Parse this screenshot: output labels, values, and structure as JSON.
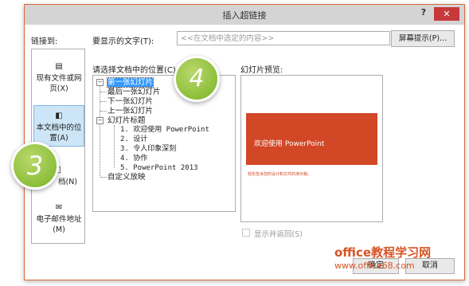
{
  "dialog": {
    "title": "插入超链接",
    "help": "?",
    "close": "✕"
  },
  "header": {
    "link_to_label": "链接到:",
    "display_text_label": "要显示的文字(T):",
    "display_text_value": "<<在文档中选定的内容>>",
    "screentip_button": "屏幕提示(P)..."
  },
  "nav": {
    "items": [
      {
        "label": "现有文件或网页(X)",
        "icon": "globe-file-icon"
      },
      {
        "label": "本文档中的位置(A)",
        "icon": "document-place-icon"
      },
      {
        "label": "新建文档(N)",
        "icon": "new-document-icon"
      },
      {
        "label": "电子邮件地址(M)",
        "icon": "email-icon"
      }
    ],
    "visible_labels": {
      "item0_line1": "现有文件或网",
      "item0_line2": "页(X)",
      "item1_line1": "本文档中的位",
      "item1_line2": "置(A)",
      "item2_visible": "档(N)",
      "item3_line1": "电子邮件地址",
      "item3_line2": "(M)"
    }
  },
  "place": {
    "label": "请选择文档中的位置(C):",
    "tree": {
      "first_slide": "第一张幻灯片",
      "last_slide": "最后一张幻灯片",
      "next_slide": "下一张幻灯片",
      "prev_slide": "上一张幻灯片",
      "slide_titles": "幻灯片标题",
      "titles": [
        "1. 欢迎使用 PowerPoint",
        "2. 设计",
        "3. 令人印象深刻",
        "4. 协作",
        "5. PowerPoint 2013"
      ],
      "custom_shows": "自定义放映"
    }
  },
  "preview": {
    "label": "幻灯片预览:",
    "slide_title": "欢迎使用 PowerPoint",
    "slide_subtitle": "轻松告诉您的设计和文件的演示稿。",
    "band_color": "#D24726",
    "show_and_return_label": "显示并返回(S)",
    "show_and_return_checked": false
  },
  "footer": {
    "ok": "确定",
    "cancel": "取消"
  },
  "annotations": {
    "bubble_3": "3",
    "bubble_4": "4",
    "accent_color": "#8CBF3A"
  },
  "watermark": {
    "line1": "office教程学习网",
    "line2": "www.office68.com"
  }
}
